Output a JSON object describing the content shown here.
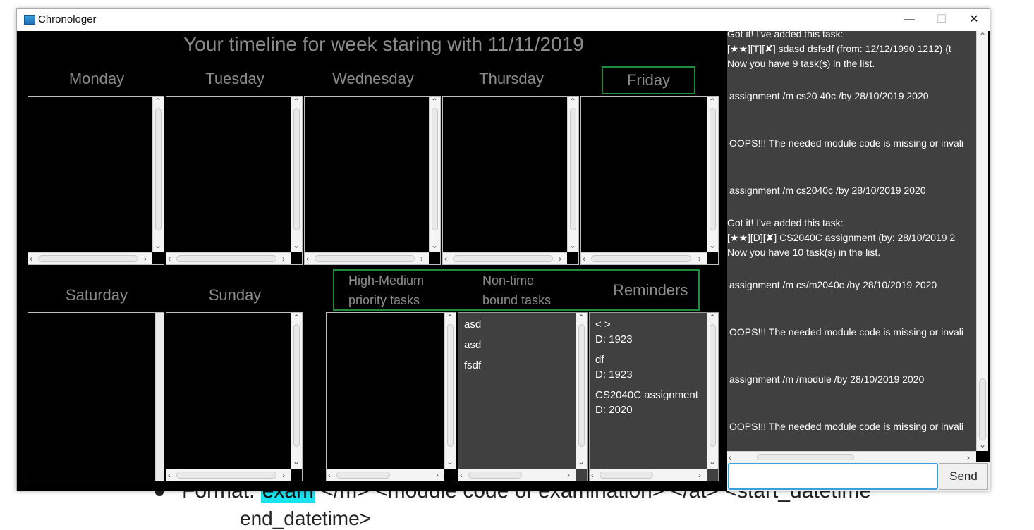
{
  "background_doc": {
    "line_prefix": "Format: ",
    "highlight": "exam",
    "line_rest": " </m> <module code of examination> </at> <start_datetime",
    "second_line": "end_datetime>"
  },
  "window": {
    "title": "Chronologer",
    "minimize": "—",
    "maximize": "☐",
    "close": "✕"
  },
  "timeline": {
    "title": "Your timeline for week staring with 11/11/2019",
    "days_top": [
      "Monday",
      "Tuesday",
      "Wednesday",
      "Thursday",
      "Friday"
    ],
    "days_bottom": [
      "Saturday",
      "Sunday"
    ],
    "highlighted_day": "Friday"
  },
  "categories": {
    "priority_line1": "High-Medium",
    "priority_line2": "priority tasks",
    "nontime_line1": "Non-time",
    "nontime_line2": "bound tasks",
    "reminders": "Reminders"
  },
  "priority_tasks": [],
  "nontime_tasks": [
    "asd",
    "asd",
    "fsdf"
  ],
  "reminders": [
    {
      "name": "< >",
      "detail": "D: 1923"
    },
    {
      "name": "df",
      "detail": "D: 1923"
    },
    {
      "name": "CS2040C assignment",
      "detail": "D: 2020"
    }
  ],
  "chat": {
    "lines": [
      "Got it! I've added this task:",
      "  [★★][T][✘] sdasd dsfsdf (from: 12/12/1990 1212) (t",
      "Now you have 9 task(s) in the list.",
      "assignment /m cs20 40c /by 28/10/2019 2020",
      "OOPS!!! The needed module code is missing or invali",
      "assignment /m cs2040c /by 28/10/2019 2020",
      "Got it! I've added this task:",
      "  [★★][D][✘] CS2040C assignment (by: 28/10/2019 2",
      "Now you have 10 task(s) in the list.",
      "assignment /m cs/m2040c /by 28/10/2019 2020",
      "OOPS!!! The needed module code is missing or invali",
      "assignment /m /module /by 28/10/2019 2020",
      "OOPS!!! The needed module code is missing or invali"
    ],
    "input_value": "",
    "send_label": "Send"
  }
}
